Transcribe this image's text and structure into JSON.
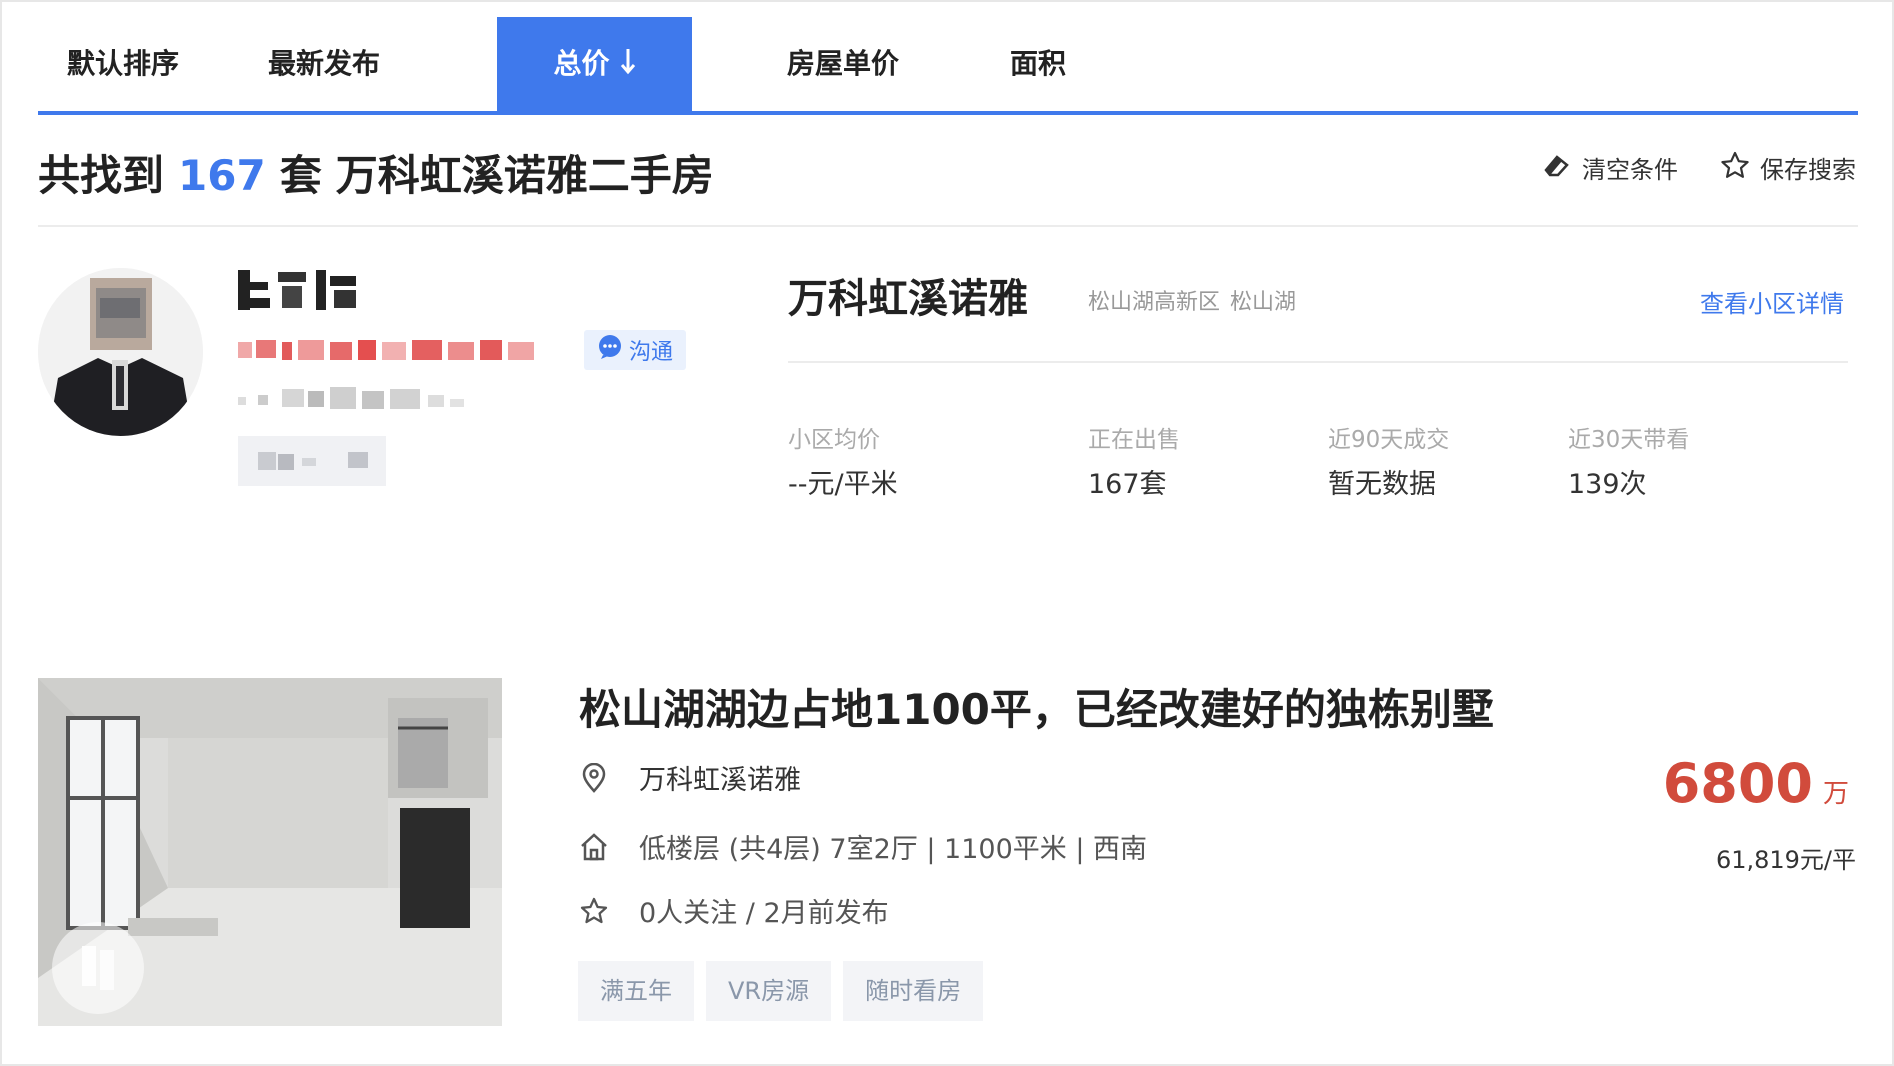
{
  "tabs": [
    {
      "label": "默认排序",
      "active": false
    },
    {
      "label": "最新发布",
      "active": false
    },
    {
      "label": "总价",
      "active": true
    },
    {
      "label": "房屋单价",
      "active": false
    },
    {
      "label": "面积",
      "active": false
    }
  ],
  "result": {
    "prefix": "共找到",
    "count": "167",
    "suffix": "套",
    "name": "万科虹溪诺雅二手房"
  },
  "actions": {
    "clear_label": "清空条件",
    "save_label": "保存搜索"
  },
  "agent": {
    "chat_label": "沟通"
  },
  "community": {
    "name": "万科虹溪诺雅",
    "district": "松山湖高新区",
    "area": "松山湖",
    "detail_link": "查看小区详情",
    "stats": [
      {
        "label": "小区均价",
        "value": "--元/平米"
      },
      {
        "label": "正在出售",
        "value": "167套"
      },
      {
        "label": "近90天成交",
        "value": "暂无数据"
      },
      {
        "label": "近30天带看",
        "value": "139次"
      }
    ]
  },
  "listing": {
    "title": "松山湖湖边占地1100平，已经改建好的独栋别墅",
    "community": "万科虹溪诺雅",
    "house_info": "低楼层 (共4层) 7室2厅 | 1100平米 | 西南",
    "follow_info": "0人关注 / 2月前发布",
    "tags": [
      "满五年",
      "VR房源",
      "随时看房"
    ],
    "price": "6800",
    "price_unit": "万",
    "unit_price": "61,819元/平"
  },
  "colors": {
    "accent": "#3f79ec",
    "price": "#d14b3c"
  }
}
